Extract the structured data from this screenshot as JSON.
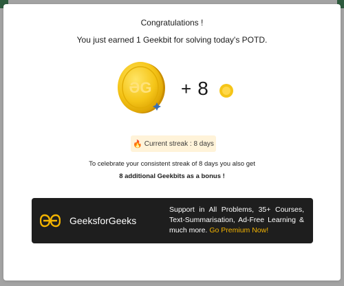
{
  "modal": {
    "title": "Congratulations !",
    "subtitle": "You just earned 1 Geekbit for solving today's POTD.",
    "reward": {
      "plus": "+",
      "amount": "8"
    },
    "streak": {
      "label": "Current streak : 8 days"
    },
    "celebrate_text": "To celebrate your consistent streak of 8 days you also get",
    "bonus_text": "8 additional Geekbits as a bonus !"
  },
  "promo": {
    "brand": "GeeksforGeeks",
    "text": "Support in All Problems, 35+ Courses, Text-Summarisation, Ad-Free Learning & much more.",
    "cta": "Go Premium Now!"
  },
  "colors": {
    "coin": "#f5c518",
    "promo_bg": "#1e1e1e",
    "cta": "#f4b400",
    "streak_bg": "#fff3d9",
    "logo_green": "#2f8d46"
  },
  "icons": {
    "coin_big": "gfg-coin-icon",
    "coin_small": "coin-icon",
    "streak": "fire-icon",
    "promo_logo": "gfg-logo-icon"
  }
}
